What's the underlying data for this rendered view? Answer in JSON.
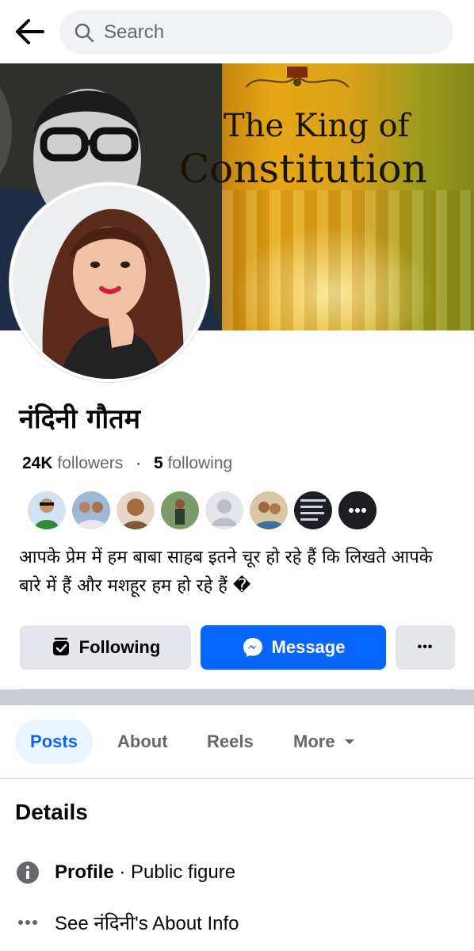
{
  "header": {
    "search_placeholder": "Search"
  },
  "cover": {
    "title_line1": "The  King of",
    "title_line2": "Constitution"
  },
  "profile": {
    "name": "नंदिनी गौतम",
    "followers_count": "24K",
    "followers_label": "followers",
    "following_count": "5",
    "following_label": "following",
    "bio": "आपके प्रेम में हम बाबा साहब इतने चूर हो रहे हैं कि लिखते आपके बारे में हैं और मशहूर हम हो रहे हैं �"
  },
  "actions": {
    "following_label": "Following",
    "message_label": "Message",
    "more_label": "•••"
  },
  "tabs": [
    {
      "label": "Posts",
      "active": true
    },
    {
      "label": "About"
    },
    {
      "label": "Reels"
    },
    {
      "label": "More"
    }
  ],
  "details": {
    "title": "Details",
    "profile_label": "Profile",
    "profile_separator": " · ",
    "profile_value": "Public figure",
    "about_link": "See नंदिनी's About Info"
  },
  "colors": {
    "accent": "#0866ff",
    "button_gray": "#e4e6eb",
    "text_secondary": "#65676b"
  }
}
